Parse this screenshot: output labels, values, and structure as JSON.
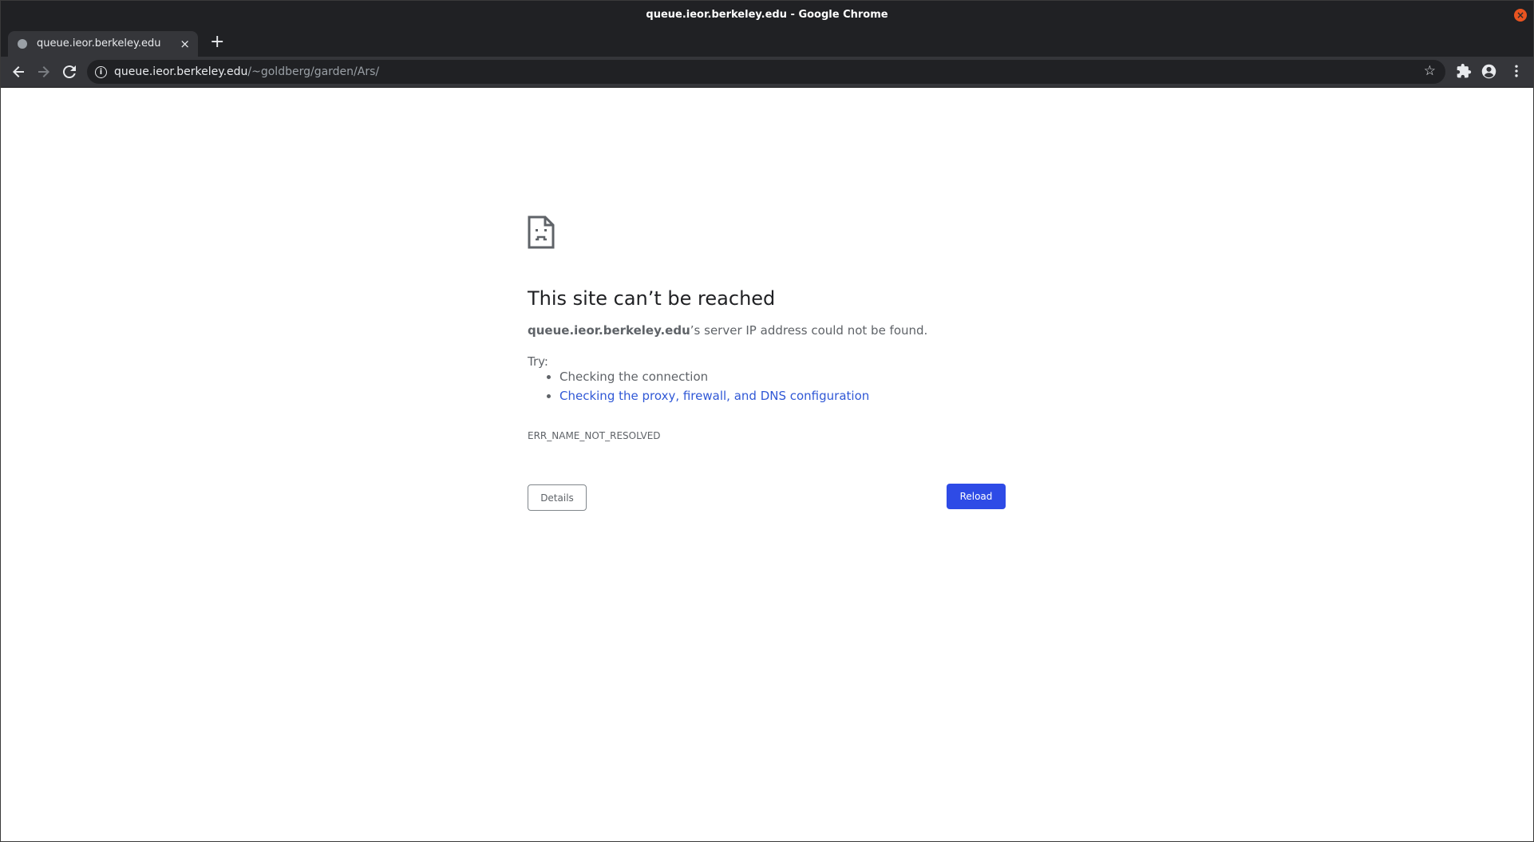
{
  "window": {
    "title": "queue.ieor.berkeley.edu - Google Chrome"
  },
  "tab": {
    "title": "queue.ieor.berkeley.edu",
    "close_symbol": "×",
    "new_tab_symbol": "+"
  },
  "toolbar": {
    "url_host": "queue.ieor.berkeley.edu",
    "url_path": "/~goldberg/garden/Ars/"
  },
  "error_page": {
    "heading": "This site can’t be reached",
    "host": "queue.ieor.berkeley.edu",
    "summary_suffix": "’s server IP address could not be found.",
    "try_label": "Try:",
    "suggestions": [
      "Checking the connection",
      "Checking the proxy, firewall, and DNS configuration"
    ],
    "error_code": "ERR_NAME_NOT_RESOLVED",
    "details_label": "Details",
    "reload_label": "Reload"
  },
  "icons": {
    "window_close": "close-icon",
    "back": "arrow-left-icon",
    "forward": "arrow-right-icon",
    "reload": "reload-icon",
    "info": "info-icon",
    "bookmark": "star-icon",
    "extensions": "puzzle-icon",
    "profile": "account-icon",
    "menu": "kebab-menu-icon",
    "error": "sad-document-icon"
  },
  "colors": {
    "chrome_dark": "#202124",
    "toolbar": "#35363a",
    "link": "#3058d6",
    "primary_button": "#2e4be6",
    "window_close": "#e95420"
  }
}
